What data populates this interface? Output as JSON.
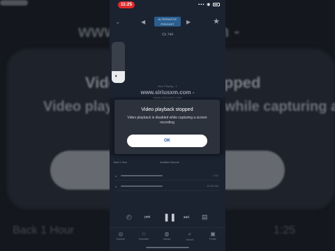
{
  "background": {
    "url_text": "www.siriusxm.com -",
    "stopped_text": "Video playback stopped",
    "disabled_text": "Video playback is disabled while capturing a",
    "footer_left": "Back 1 Hour",
    "footer_right": "1:25"
  },
  "status_bar": {
    "time": "11:25",
    "icons": "▪▪▪ ◉"
  },
  "player": {
    "channel_logo": "ALTERNATIVE\nPODCAST",
    "channel_number": "Ch 744",
    "volume_level": 0.28,
    "now_playing_label": "Now Playing - 1",
    "now_playing_url": "www.siriusxm.com -",
    "now_playing_sub": "www.siriusxm.com"
  },
  "dialog": {
    "title": "Video playback stopped",
    "body": "Video playback is disabled while capturing a screen recording",
    "ok_label": "OK"
  },
  "track": {
    "left": "Back 1 Hour",
    "right": "Available Episode"
  },
  "history": [
    {
      "time": "1:02"
    },
    {
      "time": "12:09 AM"
    }
  ],
  "tabs": [
    {
      "label": "Explore",
      "icon": "◎"
    },
    {
      "label": "Favorites",
      "icon": "☆"
    },
    {
      "label": "Library",
      "icon": "◍"
    },
    {
      "label": "Search",
      "icon": "⌕"
    },
    {
      "label": "Profile",
      "icon": "▣"
    }
  ],
  "colors": {
    "alert_red": "#e02b2b",
    "dialog_bg": "#2c323c",
    "ok_text": "#1f4f95",
    "app_bg": "#1b2230"
  }
}
